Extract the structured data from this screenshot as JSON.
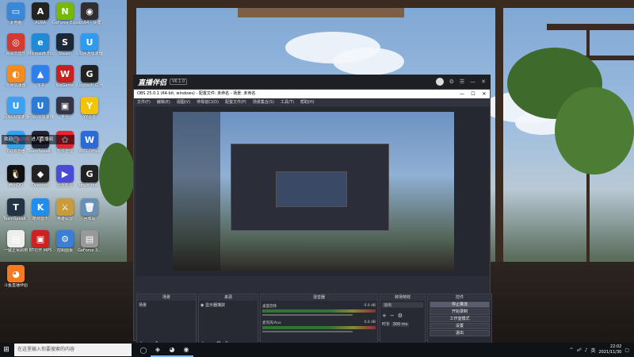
{
  "desktop": {
    "icons": [
      {
        "label": "此电脑",
        "icon": "computer-icon",
        "color": "#3a88d8",
        "glyph": "▭"
      },
      {
        "label": "AURA",
        "icon": "aura-icon",
        "color": "#222",
        "glyph": "A"
      },
      {
        "label": "GeForce Experience",
        "icon": "geforce-icon",
        "color": "#76b900",
        "glyph": "N"
      },
      {
        "label": "obs64 - 快捷方式",
        "icon": "obs-icon",
        "color": "#302e31",
        "glyph": "◉"
      },
      {
        "label": "网易云音乐",
        "icon": "netease-music-icon",
        "color": "#d33a31",
        "glyph": "◎"
      },
      {
        "label": "Microsoft Edge",
        "icon": "edge-icon",
        "color": "#1f8ad6",
        "glyph": "e"
      },
      {
        "label": "Steam",
        "icon": "steam-icon",
        "color": "#1b2838",
        "glyph": "S"
      },
      {
        "label": "UU网游加速器",
        "icon": "uu-icon",
        "color": "#2d9bf0",
        "glyph": "U"
      },
      {
        "label": "雷神加速器",
        "icon": "leishen-icon",
        "color": "#f48b1f",
        "glyph": "◐"
      },
      {
        "label": "飞书",
        "icon": "feishu-icon",
        "color": "#2f80ed",
        "glyph": "▲"
      },
      {
        "label": "WeGame",
        "icon": "wegame-icon",
        "color": "#c8201c",
        "glyph": "W"
      },
      {
        "label": "Logitech G HUB",
        "icon": "logitech-icon",
        "color": "#222",
        "glyph": "G"
      },
      {
        "label": "网易UU加速器",
        "icon": "uu-icon-2",
        "color": "#3ba1f2",
        "glyph": "U"
      },
      {
        "label": "网易UU加速器",
        "icon": "uu-icon-3",
        "color": "#2a7bd3",
        "glyph": "U"
      },
      {
        "label": "平台",
        "icon": "platform-icon",
        "color": "#334",
        "glyph": "▣"
      },
      {
        "label": "YY语音",
        "icon": "yy-icon",
        "color": "#f5c400",
        "glyph": "Y"
      },
      {
        "label": "QQ浏览器",
        "icon": "qq-browser-icon",
        "color": "#2ea4f4",
        "glyph": "Q"
      },
      {
        "label": "TeamSpeak Overlay",
        "icon": "teamspeak-overlay-icon",
        "color": "#223",
        "glyph": "T"
      },
      {
        "label": "软件管理",
        "icon": "software-manager-icon",
        "color": "#e23",
        "glyph": "✿"
      },
      {
        "label": "WPS Office",
        "icon": "wps-icon",
        "color": "#2a6bd8",
        "glyph": "W"
      },
      {
        "label": "腾讯QQ",
        "icon": "qq-icon",
        "color": "#111",
        "glyph": "🐧"
      },
      {
        "label": "Overwolf",
        "icon": "overwolf-icon",
        "color": "#222",
        "glyph": "◆"
      },
      {
        "label": "迅雷影音",
        "icon": "xunlei-player-icon",
        "color": "#4a4ad8",
        "glyph": "▶"
      },
      {
        "label": "lghub_ind...",
        "icon": "lghub-icon",
        "color": "#222",
        "glyph": "G"
      },
      {
        "label": "TeamSpeak 3 Client",
        "icon": "teamspeak-icon",
        "color": "#234",
        "glyph": "T"
      },
      {
        "label": "酷狗音乐",
        "icon": "kugou-icon",
        "color": "#1f8ef0",
        "glyph": "K"
      },
      {
        "label": "英雄联盟",
        "icon": "lol-icon",
        "color": "#c89b3c",
        "glyph": "⚔"
      },
      {
        "label": "回收站",
        "icon": "recycle-bin-icon",
        "color": "#6a8fb8",
        "glyph": "🗑"
      },
      {
        "label": "一键正常启用",
        "icon": "file-icon",
        "color": "#eee",
        "glyph": "▤"
      },
      {
        "label": "BT打开 MP5",
        "icon": "bt-icon",
        "color": "#c22",
        "glyph": "▣"
      },
      {
        "label": "控制面板",
        "icon": "control-panel-icon",
        "color": "#3a7fd1",
        "glyph": "⚙"
      },
      {
        "label": "GeForce 3...",
        "icon": "geforce-file-icon",
        "color": "#999",
        "glyph": "▤"
      },
      {
        "label": "斗鱼直播伴侣",
        "icon": "douyu-icon",
        "color": "#f47b20",
        "glyph": "◕"
      }
    ]
  },
  "chat_overlay": {
    "prefix": "欢迎 ",
    "user": "我LOVE",
    "suffix": " 进入直播间"
  },
  "assistant": {
    "logo": "直播伴侣",
    "version": "V6.1.0"
  },
  "obs": {
    "title": "OBS 25.0.1 (64-bit, windows) - 配置文件: 未命名 - 场景: 未命名",
    "menu": [
      "文件(F)",
      "编辑(E)",
      "视图(V)",
      "停靠窗口(D)",
      "配置文件(P)",
      "场景集合(S)",
      "工具(T)",
      "帮助(H)"
    ],
    "docks": {
      "scenes": {
        "title": "场景",
        "items": [
          "场景"
        ]
      },
      "sources": {
        "title": "来源",
        "items": [
          "显示器捕获"
        ]
      },
      "mixer": {
        "title": "混音器",
        "channels": [
          {
            "name": "桌面音频",
            "db": "0.0 dB"
          },
          {
            "name": "麦克风/Aux",
            "db": "0.0 dB"
          }
        ]
      },
      "transitions": {
        "title": "转场特效",
        "type": "淡出",
        "duration_label": "时长",
        "duration": "300 ms"
      },
      "controls": {
        "title": "控件",
        "buttons": [
          "停止推流",
          "开始录制",
          "工作室模式",
          "设置",
          "退出"
        ]
      }
    },
    "status": {
      "live": "LIVE: 00:00:00",
      "rec": "REC: 00:00:00",
      "cpu": "CPU: 0.0%, 60.00 fps"
    }
  },
  "taskbar": {
    "search_placeholder": "在这里输入你要搜索的内容",
    "apps": [
      {
        "name": "task-view",
        "glyph": "◯"
      },
      {
        "name": "steam",
        "glyph": "◈"
      },
      {
        "name": "douyu",
        "glyph": "◕"
      },
      {
        "name": "obs",
        "glyph": "◉"
      }
    ],
    "tray": {
      "up": "^",
      "lang": "英",
      "time": "22:02",
      "date": "2021/11/30"
    }
  }
}
